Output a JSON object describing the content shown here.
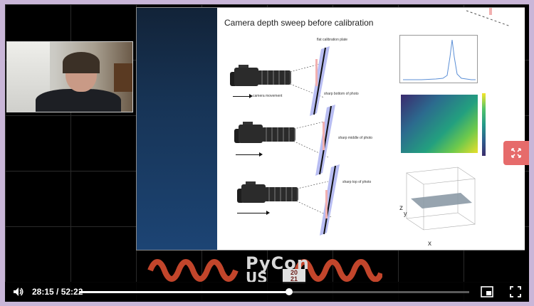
{
  "slide": {
    "title": "Camera depth sweep before calibration",
    "labels": {
      "plate": "flat calibration plate",
      "movement": "camera movement",
      "bottom": "sharp bottom of photo",
      "middle": "sharp middle of photo",
      "top": "sharp top of photo"
    },
    "plot_axis_3d": "x",
    "plot_axis_3d_z": "z",
    "plot_axis_3d_y": "y"
  },
  "banner": {
    "line1": "PyCon",
    "line2": "US",
    "year_top": "20",
    "year_bottom": "21"
  },
  "controls": {
    "time": "28:15 / 52:22",
    "progress": 0.539
  },
  "colors": {
    "accent_button": "#e66b6b",
    "banner_snake": "#c2452b",
    "frame_bg": "#c9b6d8"
  }
}
